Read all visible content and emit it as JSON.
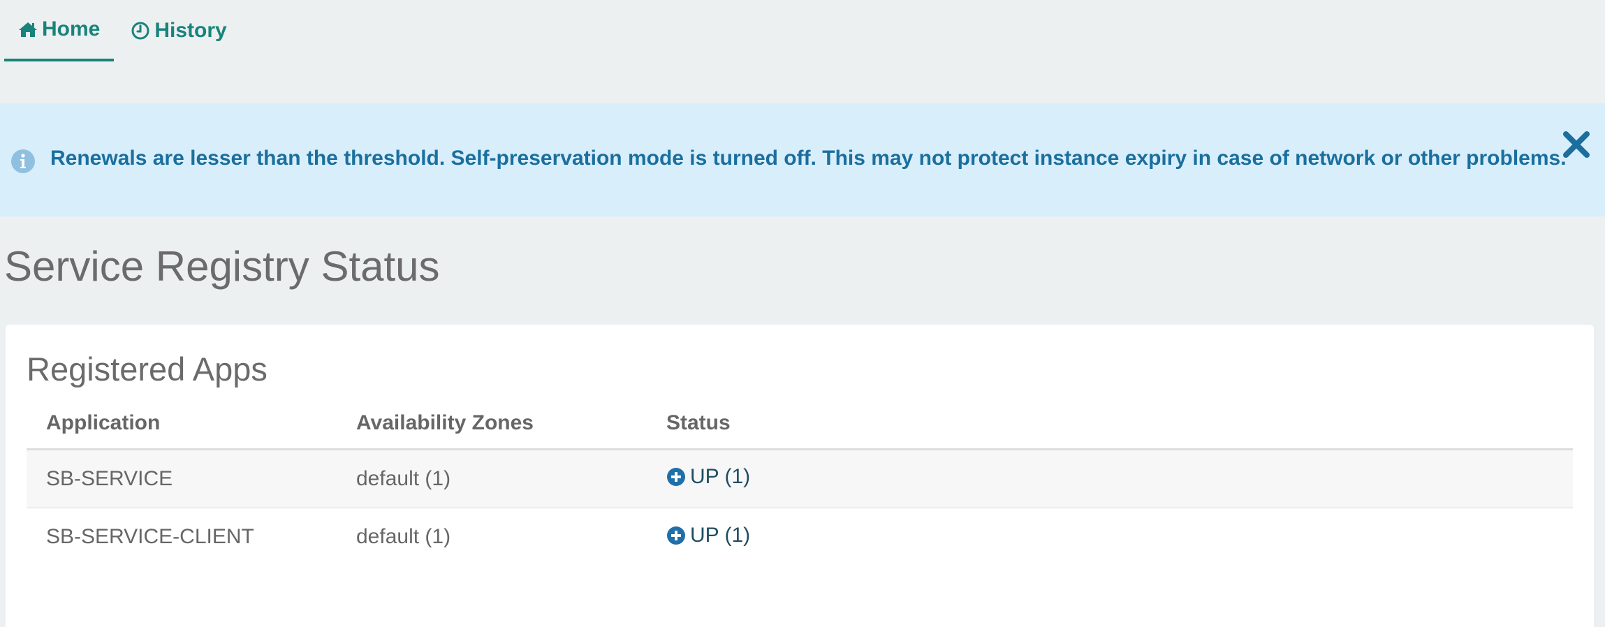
{
  "nav": {
    "items": [
      {
        "label": "Home",
        "icon": "home-icon",
        "active": true
      },
      {
        "label": "History",
        "icon": "clock-icon",
        "active": false
      }
    ],
    "accent_color": "#18837b"
  },
  "alert": {
    "message": "Renewals are lesser than the threshold. Self-preservation mode is turned off. This may not protect instance expiry in case of network or other problems.",
    "icon": "info-icon",
    "close_icon": "close-icon",
    "background": "#d9eefb",
    "text_color": "#1a6f9e"
  },
  "page": {
    "title": "Service Registry Status"
  },
  "registered_apps": {
    "title": "Registered Apps",
    "columns": [
      "Application",
      "Availability Zones",
      "Status"
    ],
    "rows": [
      {
        "application": "SB-SERVICE",
        "zones": "default (1)",
        "status": "UP (1)",
        "status_icon": "plus-circle-icon"
      },
      {
        "application": "SB-SERVICE-CLIENT",
        "zones": "default (1)",
        "status": "UP (1)",
        "status_icon": "plus-circle-icon"
      }
    ]
  }
}
